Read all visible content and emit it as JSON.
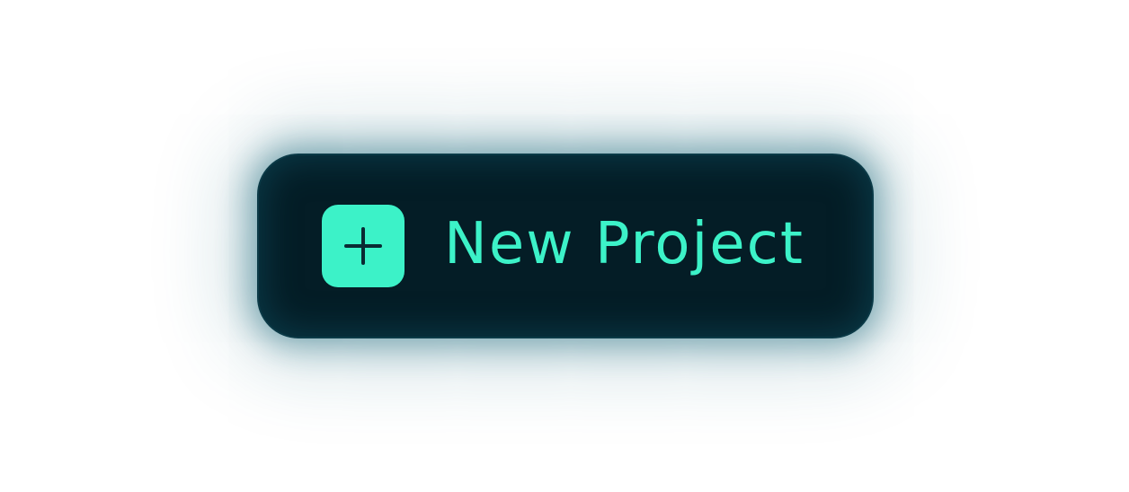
{
  "button": {
    "label": "New Project",
    "icon": "plus-icon"
  },
  "colors": {
    "accent": "#3cf2c8",
    "button_background": "#041d26",
    "glow": "#126276",
    "page_background": "#ffffff"
  }
}
